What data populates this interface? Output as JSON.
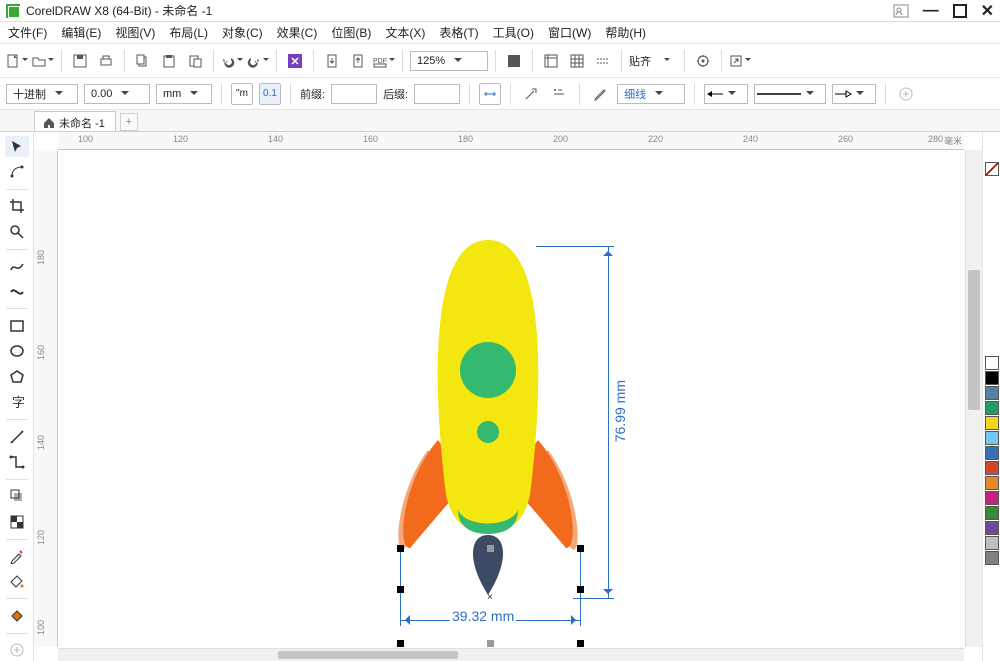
{
  "titlebar": {
    "title": "CorelDRAW X8 (64-Bit) - 未命名 -1"
  },
  "menus": [
    "文件(F)",
    "编辑(E)",
    "视图(V)",
    "布局(L)",
    "对象(C)",
    "效果(C)",
    "位图(B)",
    "文本(X)",
    "表格(T)",
    "工具(O)",
    "窗口(W)",
    "帮助(H)"
  ],
  "toolbar1": {
    "zoom": "125%",
    "align_label": "贴齐"
  },
  "toolbar2": {
    "numsys": "十进制",
    "precision": "0.00",
    "unit": "mm",
    "prefix_label": "前缀:",
    "suffix_label": "后缀:",
    "outline": "细线"
  },
  "tab": {
    "label": "未命名 -1"
  },
  "ruler": {
    "h": [
      "100",
      "120",
      "140",
      "160",
      "180",
      "200",
      "220",
      "240",
      "260",
      "280"
    ],
    "h_unit": "毫米",
    "v": [
      "180",
      "160",
      "140",
      "120",
      "100"
    ]
  },
  "dimensions": {
    "width": "39.32 mm",
    "height": "76.99 mm"
  },
  "palette": [
    "#ffffff",
    "#000000",
    "#5b7ea3",
    "#1e9e63",
    "#f2d423",
    "#73c8f0",
    "#3b6fb5",
    "#d2452e",
    "#e28a28",
    "#c1237e",
    "#3a8a3a",
    "#6b4a9a",
    "#bfbfbf",
    "#808080"
  ],
  "toolbox_icons": [
    "pick-tool",
    "shape-tool",
    "crop-tool",
    "zoom-tool",
    "freehand-tool",
    "artistic-media-tool",
    "rectangle-tool",
    "ellipse-tool",
    "polygon-tool",
    "text-tool",
    "parallel-dimension-tool",
    "connector-tool",
    "drop-shadow-tool",
    "transparency-tool",
    "eyedropper-tool",
    "outline-tool",
    "fill-tool",
    "interactive-fill-tool"
  ]
}
